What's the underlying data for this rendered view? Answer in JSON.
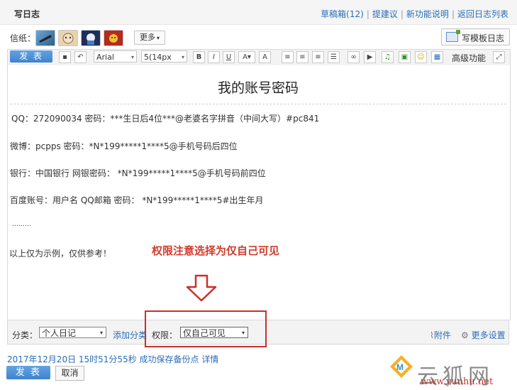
{
  "header": {
    "title": "写日志",
    "links": [
      "草稿箱(12)",
      "提建议",
      "新功能说明",
      "返回日志列表"
    ]
  },
  "stationery": {
    "label": "信纸：",
    "more_label": "更多",
    "template_button": "写模板日志"
  },
  "toolbar": {
    "publish_label": "发 表",
    "font_family": "Arial",
    "font_size": "5(14px",
    "advanced_label": "高级功能"
  },
  "document": {
    "title": "我的账号密码",
    "lines": [
      "QQ：272090034 密码：***生日后4位***@老婆名字拼音（中间大写）#pc841",
      "微博：pcpps 密码：*N*199*****1****5@手机号码后四位",
      "银行：中国银行 网银密码： *N*199*****1****5@手机号码前四位",
      "百度账号：用户名 QQ邮箱 密码： *N*199*****1****5#出生年月",
      "………",
      "以上仅为示例，仅供参考！"
    ],
    "notice": "权限注意选择为仅自己可见"
  },
  "footer_bar": {
    "category_label": "分类：",
    "category_value": "个人日记",
    "add_category": "添加分类",
    "permission_label": "权限：",
    "permission_value": "仅自己可见",
    "attachment_label": "附件",
    "more_settings_label": "更多设置"
  },
  "status": {
    "save_text": "2017年12月20日 15时51分55秒 成功保存备份点",
    "detail_link": "详情"
  },
  "actions": {
    "publish_label": "发 表",
    "cancel_label": "取消"
  },
  "watermark": {
    "text": "云狐网",
    "url": "www.yunhu.net"
  },
  "colors": {
    "link": "#2a6db8",
    "notice": "#d43a2c",
    "publish_button": "#3f83cd"
  }
}
